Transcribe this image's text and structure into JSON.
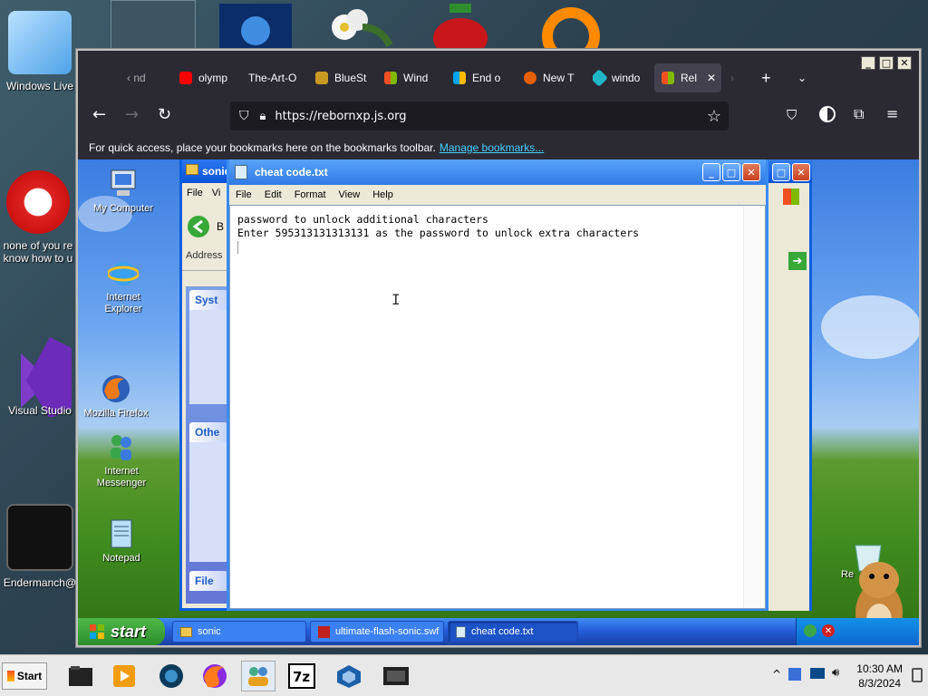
{
  "outer_desktop": {
    "icons": [
      {
        "label": "Windows Live"
      },
      {
        "label": "none of you re know how to u"
      },
      {
        "label": "Visual Studio"
      },
      {
        "label": "Endermanch@"
      }
    ]
  },
  "outer_taskbar": {
    "start_label": "Start",
    "clock_time": "10:30 AM",
    "clock_date": "8/3/2024"
  },
  "browser": {
    "tabs": [
      {
        "label": "‹ nd"
      },
      {
        "label": "olymp"
      },
      {
        "label": "The-Art-O"
      },
      {
        "label": "BlueSt"
      },
      {
        "label": "Wind"
      },
      {
        "label": "End o"
      },
      {
        "label": "New T"
      },
      {
        "label": "windo"
      },
      {
        "label": "Rel"
      }
    ],
    "url": "https://rebornxp.js.org",
    "bookmarks_text": "For quick access, place your bookmarks here on the bookmarks toolbar.",
    "bookmarks_link": "Manage bookmarks..."
  },
  "xp_desktop": {
    "icons": [
      {
        "label": "My Computer"
      },
      {
        "label": "Internet Explorer"
      },
      {
        "label": "Mozilla Firefox"
      },
      {
        "label": "Internet Messenger"
      },
      {
        "label": "Notepad"
      }
    ],
    "recycle_label": "Re"
  },
  "explorer": {
    "title": "sonic",
    "menu_file": "File",
    "menu_view": "Vi",
    "back_label": "B",
    "address_label": "Address",
    "panel_system": "Syst",
    "panel_other": "Othe",
    "panel_file": "File"
  },
  "notepad": {
    "title": "cheat code.txt",
    "menu": [
      "File",
      "Edit",
      "Format",
      "View",
      "Help"
    ],
    "line1": "password to unlock additional characters",
    "line2": "Enter 595313131313131 as the password to unlock extra characters"
  },
  "xp_taskbar": {
    "start_label": "start",
    "tasks": [
      {
        "label": "sonic"
      },
      {
        "label": "ultimate-flash-sonic.swf"
      },
      {
        "label": "cheat code.txt"
      }
    ]
  },
  "colors": {
    "ff_bg": "#2b2a33",
    "xp_blue": "#245edb",
    "xp_start_green": "#2d8e2b",
    "link": "#45d0ff"
  }
}
